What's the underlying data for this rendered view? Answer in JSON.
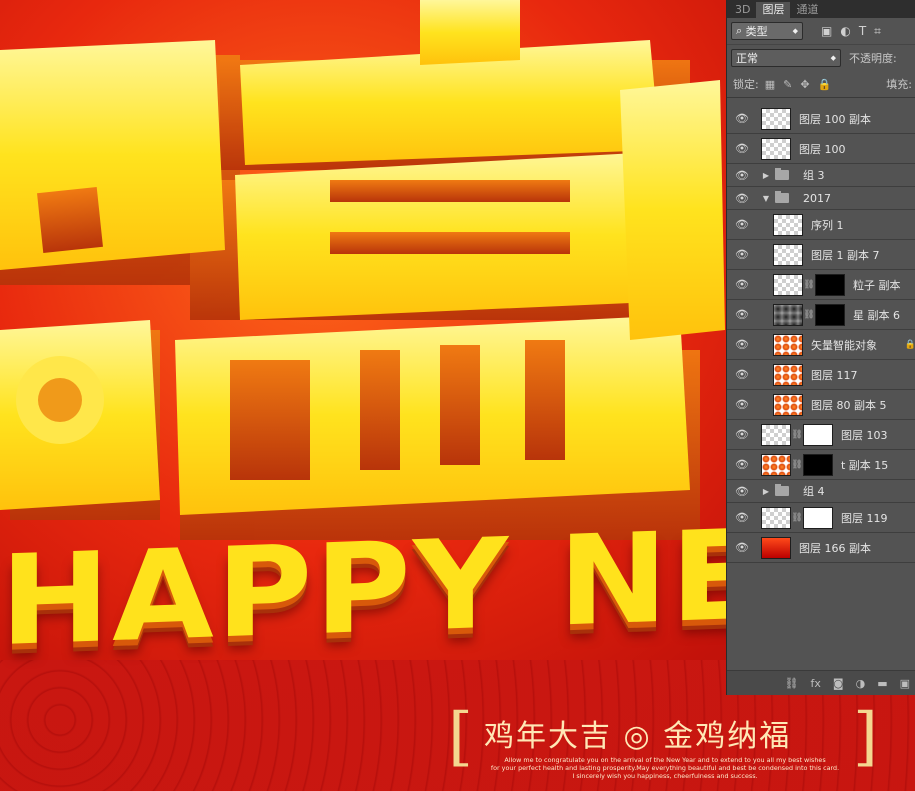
{
  "canvas": {
    "headline": "HAPPY NE",
    "slogan": {
      "bracket_left": "[",
      "bracket_right": "]",
      "title": "鸡年大吉 ◎ 金鸡纳福",
      "line1": "Allow me to congratulate you on the arrival of the New Year and to extend to you all my best wishes",
      "line2": "for your perfect health and lasting prosperity.May everything beautiful and best be condensed into this card.",
      "line3": "I sincerely wish you happiness, cheerfulness and success."
    },
    "colors": {
      "background_red": "#c3120a",
      "gold": "#ffe21c",
      "gold_shadow": "#d8590a"
    }
  },
  "panel": {
    "tabs": [
      {
        "label": "3D",
        "active": false
      },
      {
        "label": "图层",
        "active": true
      },
      {
        "label": "通道",
        "active": false
      }
    ],
    "filter": {
      "search_icon": "search-icon",
      "value": "类型",
      "arrow": "◆"
    },
    "filter_icons": [
      "▣",
      "◐",
      "T",
      "⌗"
    ],
    "blend_mode": {
      "value": "正常",
      "arrow": "◆"
    },
    "opacity_label": "不透明度:",
    "lock_label": "锁定:",
    "lock_icons": [
      "▦",
      "✎",
      "✥",
      "🔒"
    ],
    "fill_label": "填充:",
    "layers": [
      {
        "name": "图层 100 副本",
        "kind": "layer",
        "thumb": "checker",
        "indent": 0
      },
      {
        "name": "图层 100",
        "kind": "layer",
        "thumb": "checker",
        "indent": 0
      },
      {
        "name": "组 3",
        "kind": "group",
        "expanded": false,
        "indent": 0
      },
      {
        "name": "2017",
        "kind": "group",
        "expanded": true,
        "indent": 0
      },
      {
        "name": "序列 1",
        "kind": "layer",
        "thumb": "checker",
        "indent": 1
      },
      {
        "name": "图层 1 副本 7",
        "kind": "layer",
        "thumb": "checker",
        "indent": 1
      },
      {
        "name": "粒子 副本",
        "kind": "layer",
        "thumb": "checker",
        "mask": "black",
        "indent": 1
      },
      {
        "name": "星 副本 6",
        "kind": "layer",
        "thumb": "dark",
        "mask": "black",
        "indent": 1
      },
      {
        "name": "矢量智能对象",
        "kind": "layer",
        "thumb": "orange",
        "indent": 1,
        "locked": true
      },
      {
        "name": "图层 117",
        "kind": "layer",
        "thumb": "orange",
        "indent": 1
      },
      {
        "name": "图层 80 副本 5",
        "kind": "layer",
        "thumb": "orange",
        "indent": 1
      },
      {
        "name": "图层 103",
        "kind": "layer",
        "thumb": "checker",
        "mask": "white",
        "indent": 0
      },
      {
        "name": "t 副本 15",
        "kind": "layer",
        "thumb": "orange",
        "mask": "black",
        "indent": 0
      },
      {
        "name": "组 4",
        "kind": "group",
        "expanded": false,
        "indent": 0
      },
      {
        "name": "图层 119",
        "kind": "layer",
        "thumb": "checker",
        "mask": "white",
        "indent": 0
      },
      {
        "name": "图层 166 副本",
        "kind": "layer",
        "thumb": "red",
        "indent": 0
      }
    ],
    "bottom_icons": [
      "⛓",
      "fx",
      "◙",
      "◑",
      "▬",
      "▣"
    ]
  }
}
